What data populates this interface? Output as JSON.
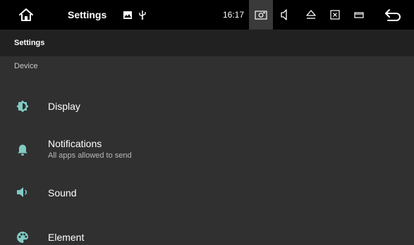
{
  "topbar": {
    "title": "Settings",
    "clock": "16:17",
    "icons": {
      "home": "home-icon",
      "image": "image-notification-icon",
      "usb": "usb-icon",
      "screenshot": "screenshot-icon",
      "volume": "volume-icon",
      "eject": "eject-icon",
      "close": "close-box-icon",
      "window": "window-icon",
      "back": "back-icon"
    }
  },
  "header": {
    "title": "Settings"
  },
  "section": {
    "title": "Device"
  },
  "items": [
    {
      "title": "Display",
      "subtitle": "",
      "icon": "brightness-icon"
    },
    {
      "title": "Notifications",
      "subtitle": "All apps allowed to send",
      "icon": "bell-icon"
    },
    {
      "title": "Sound",
      "subtitle": "",
      "icon": "speaker-icon"
    },
    {
      "title": "Element",
      "subtitle": "",
      "icon": "palette-icon"
    }
  ],
  "colors": {
    "accent": "#80cbc4",
    "background": "#303030",
    "header": "#212121",
    "statusbar": "#000000"
  }
}
